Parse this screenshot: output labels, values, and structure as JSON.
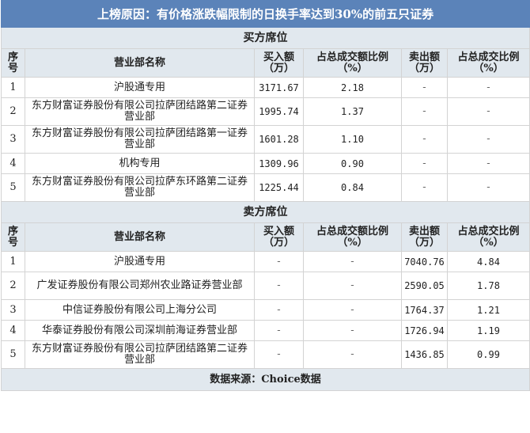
{
  "title": "上榜原因：有价格涨跌幅限制的日换手率达到30%的前五只证券",
  "columns": [
    "序号",
    "营业部名称",
    "买入额（万）",
    "占总成交额比例（%）",
    "卖出额（万）",
    "占总成交比例（%）"
  ],
  "buy_section": {
    "label": "买方席位",
    "rows": [
      {
        "no": "1",
        "name": "沪股通专用",
        "buy": "3171.67",
        "buy_pct": "2.18",
        "sell": "-",
        "sell_pct": "-"
      },
      {
        "no": "2",
        "name": "东方财富证券股份有限公司拉萨团结路第二证券营业部",
        "buy": "1995.74",
        "buy_pct": "1.37",
        "sell": "-",
        "sell_pct": "-"
      },
      {
        "no": "3",
        "name": "东方财富证券股份有限公司拉萨团结路第一证券营业部",
        "buy": "1601.28",
        "buy_pct": "1.10",
        "sell": "-",
        "sell_pct": "-"
      },
      {
        "no": "4",
        "name": "机构专用",
        "buy": "1309.96",
        "buy_pct": "0.90",
        "sell": "-",
        "sell_pct": "-"
      },
      {
        "no": "5",
        "name": "东方财富证券股份有限公司拉萨东环路第二证券营业部",
        "buy": "1225.44",
        "buy_pct": "0.84",
        "sell": "-",
        "sell_pct": "-"
      }
    ]
  },
  "sell_section": {
    "label": "卖方席位",
    "rows": [
      {
        "no": "1",
        "name": "沪股通专用",
        "buy": "-",
        "buy_pct": "-",
        "sell": "7040.76",
        "sell_pct": "4.84"
      },
      {
        "no": "2",
        "name": "广发证券股份有限公司郑州农业路证券营业部",
        "buy": "-",
        "buy_pct": "-",
        "sell": "2590.05",
        "sell_pct": "1.78"
      },
      {
        "no": "3",
        "name": "中信证券股份有限公司上海分公司",
        "buy": "-",
        "buy_pct": "-",
        "sell": "1764.37",
        "sell_pct": "1.21"
      },
      {
        "no": "4",
        "name": "华泰证券股份有限公司深圳前海证券营业部",
        "buy": "-",
        "buy_pct": "-",
        "sell": "1726.94",
        "sell_pct": "1.19"
      },
      {
        "no": "5",
        "name": "东方财富证券股份有限公司拉萨团结路第二证券营业部",
        "buy": "-",
        "buy_pct": "-",
        "sell": "1436.85",
        "sell_pct": "0.99"
      }
    ]
  },
  "footer": "数据来源：Choice数据"
}
